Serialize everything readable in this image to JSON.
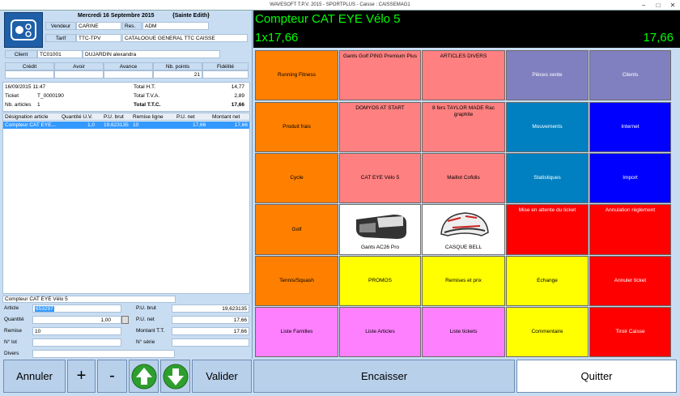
{
  "window": {
    "title": "WAVESOFT T.P.V. 2015 - SPORTPLUS - Caisse : CAISSEMAG1",
    "btn_min": "−",
    "btn_max": "□",
    "btn_close": "✕"
  },
  "header": {
    "date": "Mercredi 16 Septembre 2015",
    "saint": "{Sainte Edith}",
    "vendeur_label": "Vendeur",
    "vendeur_value": "CARINE",
    "res_label": "Res.",
    "res_value": "ADM",
    "tarif_label": "Tarif",
    "tarif_value": "TTC-TPV",
    "catalogue_value": "CATALOGUE GENERAL TTC CAISSE"
  },
  "client": {
    "label": "Client",
    "code": "TC01001",
    "name": "DUJARDIN alexandra",
    "cols": [
      "Crédit",
      "Avoir",
      "Avance",
      "Nb. points",
      "Fidélité"
    ],
    "values": [
      "",
      "",
      "",
      "21",
      ""
    ]
  },
  "ticket": {
    "datetime": "16/09/2015 11:47",
    "ticket_label": "Ticket",
    "ticket_value": "T_0000190",
    "nb_label": "Nb. articles",
    "nb_value": "1",
    "ht_label": "Total H.T.",
    "ht_value": "14,77",
    "tva_label": "Total T.V.A.",
    "tva_value": "2,89",
    "ttc_label": "Total T.T.C.",
    "ttc_value": "17,66"
  },
  "lines": {
    "headers": [
      "Désignation article",
      "Quantité U.V.",
      "P.U. brut",
      "Remise ligne",
      "P.U. net",
      "Montant net"
    ],
    "rows": [
      [
        "Compteur CAT EYE...",
        "1,0",
        "19,623135",
        "10",
        "17,66",
        "17,66"
      ]
    ]
  },
  "detail": {
    "title": "Compteur CAT EYE Vélo 5",
    "article_label": "Article",
    "article_value": "653297",
    "quantite_label": "Quantité",
    "quantite_value": "1,00",
    "remise_label": "Remise",
    "remise_value": "10",
    "nlot_label": "N° lot",
    "nlot_value": "",
    "divers_label": "Divers",
    "divers_value": "",
    "pubrut_label": "P.U. brut",
    "pubrut_value": "19,623135",
    "punet_label": "P.U. net",
    "punet_value": "17,66",
    "montant_label": "Montant T.T.",
    "montant_value": "17,66",
    "nserie_label": "N° série",
    "nserie_value": ""
  },
  "display": {
    "line1": "Compteur CAT EYE Vélo 5",
    "line2": "1x17,66",
    "total": "17,66"
  },
  "tiles": [
    [
      "Running Fitness",
      "Gants Golf PING Premium Plus",
      "ARTICLES DIVERS",
      "Pièces vente",
      "Clients"
    ],
    [
      "Produit frais",
      "DOMYOS AT START",
      "8 fers TAYLOR MADE Rac graphite",
      "Mouvements",
      "Internet"
    ],
    [
      "Cycle",
      "CAT EYE Vélo 5",
      "Maillot Cofidis",
      "Statistiques",
      "Import"
    ],
    [
      "Golf",
      "Gants AC26 Pro",
      "CASQUE BELL",
      "Mise en attente du ticket",
      "Annulation règlement"
    ],
    [
      "Tennis/Squash",
      "PROMOS",
      "Remises et prix",
      "Echange",
      "Annuler ticket"
    ],
    [
      "Liste Familles",
      "Liste Articles",
      "Liste tickets",
      "Commentaire",
      "Tiroir Caisse"
    ]
  ],
  "tile_colors": [
    [
      "#ff8000",
      "#ff8080",
      "#ff8080",
      "#8080c0",
      "#8080c0"
    ],
    [
      "#ff8000",
      "#ff8080",
      "#ff8080",
      "#0080c0",
      "#0000ff"
    ],
    [
      "#ff8000",
      "#ff8080",
      "#ff8080",
      "#0080c0",
      "#0000ff"
    ],
    [
      "#ff8000",
      "#ffffff",
      "#ffffff",
      "#ff0000",
      "#ff0000"
    ],
    [
      "#ff8000",
      "#ffff00",
      "#ffff00",
      "#ffff00",
      "#ff0000"
    ],
    [
      "#ff80ff",
      "#ff80ff",
      "#ff80ff",
      "#ffff00",
      "#ff0000"
    ]
  ],
  "buttons": {
    "annuler": "Annuler",
    "plus": "+",
    "minus": "-",
    "up_icon": "arrow-up-icon",
    "down_icon": "arrow-down-icon",
    "valider": "Valider",
    "encaisser": "Encaisser",
    "quitter": "Quitter"
  },
  "colors": {
    "display_text": "#00ff00",
    "selected_row": "#3399ff"
  }
}
